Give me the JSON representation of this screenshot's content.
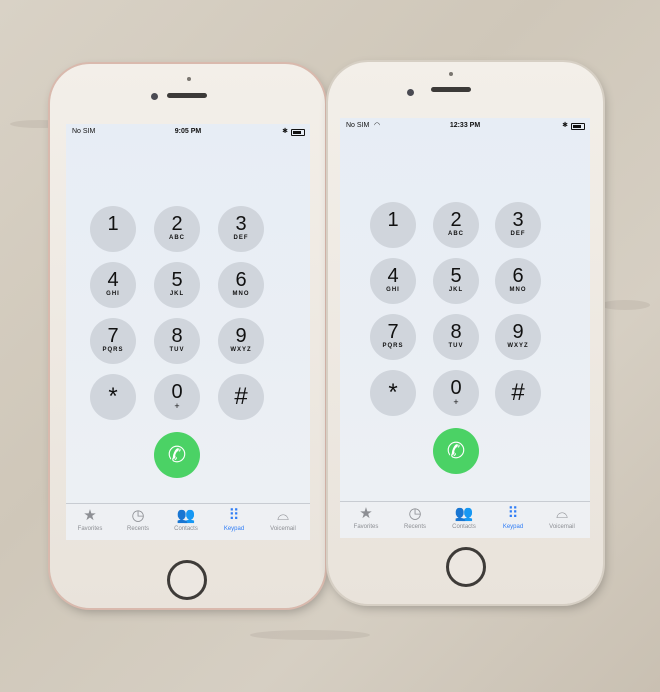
{
  "phones": [
    {
      "status": {
        "carrier": "No SIM",
        "time": "9:05 PM",
        "bluetooth": "✱"
      },
      "keys": [
        {
          "num": "1",
          "letters": ""
        },
        {
          "num": "2",
          "letters": "ABC"
        },
        {
          "num": "3",
          "letters": "DEF"
        },
        {
          "num": "4",
          "letters": "GHI"
        },
        {
          "num": "5",
          "letters": "JKL"
        },
        {
          "num": "6",
          "letters": "MNO"
        },
        {
          "num": "7",
          "letters": "PQRS"
        },
        {
          "num": "8",
          "letters": "TUV"
        },
        {
          "num": "9",
          "letters": "WXYZ"
        },
        {
          "num": "*",
          "letters": ""
        },
        {
          "num": "0",
          "letters": "+"
        },
        {
          "num": "#",
          "letters": ""
        }
      ],
      "tabs": [
        "Favorites",
        "Recents",
        "Contacts",
        "Keypad",
        "Voicemail"
      ]
    },
    {
      "status": {
        "carrier": "No SIM",
        "time": "12:33 PM",
        "bluetooth": "✱"
      },
      "keys": [
        {
          "num": "1",
          "letters": ""
        },
        {
          "num": "2",
          "letters": "ABC"
        },
        {
          "num": "3",
          "letters": "DEF"
        },
        {
          "num": "4",
          "letters": "GHI"
        },
        {
          "num": "5",
          "letters": "JKL"
        },
        {
          "num": "6",
          "letters": "MNO"
        },
        {
          "num": "7",
          "letters": "PQRS"
        },
        {
          "num": "8",
          "letters": "TUV"
        },
        {
          "num": "9",
          "letters": "WXYZ"
        },
        {
          "num": "*",
          "letters": ""
        },
        {
          "num": "0",
          "letters": "+"
        },
        {
          "num": "#",
          "letters": ""
        }
      ],
      "tabs": [
        "Favorites",
        "Recents",
        "Contacts",
        "Keypad",
        "Voicemail"
      ]
    }
  ],
  "icons": {
    "favorites": "star-icon",
    "recents": "clock-icon",
    "contacts": "people-icon",
    "keypad": "keypad-grid-icon",
    "voicemail": "voicemail-icon",
    "call": "phone-handset-icon"
  },
  "colors": {
    "call_button": "#4bd265",
    "active_tab": "#2f7df6",
    "key_fill": "#d0d5dc"
  }
}
